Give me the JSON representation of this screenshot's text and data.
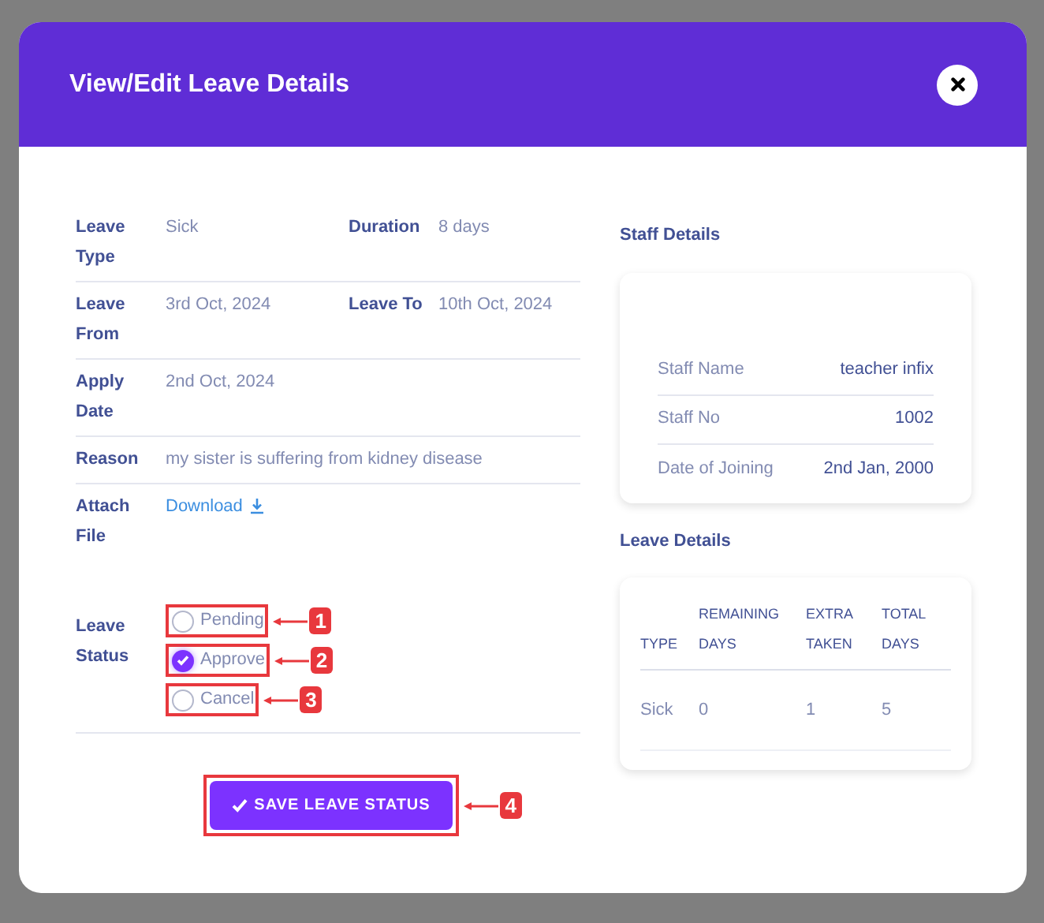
{
  "modal": {
    "title": "View/Edit Leave Details",
    "details": [
      {
        "cells": [
          {
            "label": "Leave Type",
            "value": "Sick"
          },
          {
            "label": "Duration",
            "value": "8 days"
          }
        ]
      },
      {
        "cells": [
          {
            "label": "Leave From",
            "value": "3rd Oct, 2024"
          },
          {
            "label": "Leave To",
            "value": "10th Oct, 2024"
          }
        ]
      },
      {
        "cells": [
          {
            "label": "Apply Date",
            "value": "2nd Oct, 2024"
          }
        ]
      },
      {
        "cells": [
          {
            "label": "Reason",
            "value": "my sister is suffering from kidney disease"
          }
        ]
      }
    ],
    "attachment": {
      "label": "Attach File",
      "link": "Download"
    },
    "leave_status": {
      "label": "Leave Status",
      "options": [
        {
          "label": "Pending",
          "selected": false,
          "callout": "1"
        },
        {
          "label": "Approve",
          "selected": true,
          "callout": "2"
        },
        {
          "label": "Cancel",
          "selected": false,
          "callout": "3"
        }
      ]
    },
    "save_button": {
      "label": "SAVE LEAVE STATUS",
      "callout": "4"
    },
    "staff_details": {
      "title": "Staff Details",
      "rows": [
        {
          "label": "Staff Name",
          "value": "teacher infix"
        },
        {
          "label": "Staff No",
          "value": "1002"
        },
        {
          "label": "Date of Joining",
          "value": "2nd Jan, 2000"
        }
      ]
    },
    "leave_details": {
      "title": "Leave Details",
      "columns": [
        "TYPE",
        "REMAINING DAYS",
        "EXTRA TAKEN",
        "TOTAL DAYS"
      ],
      "rows": [
        [
          "Sick",
          "0",
          "1",
          "5"
        ]
      ]
    }
  }
}
